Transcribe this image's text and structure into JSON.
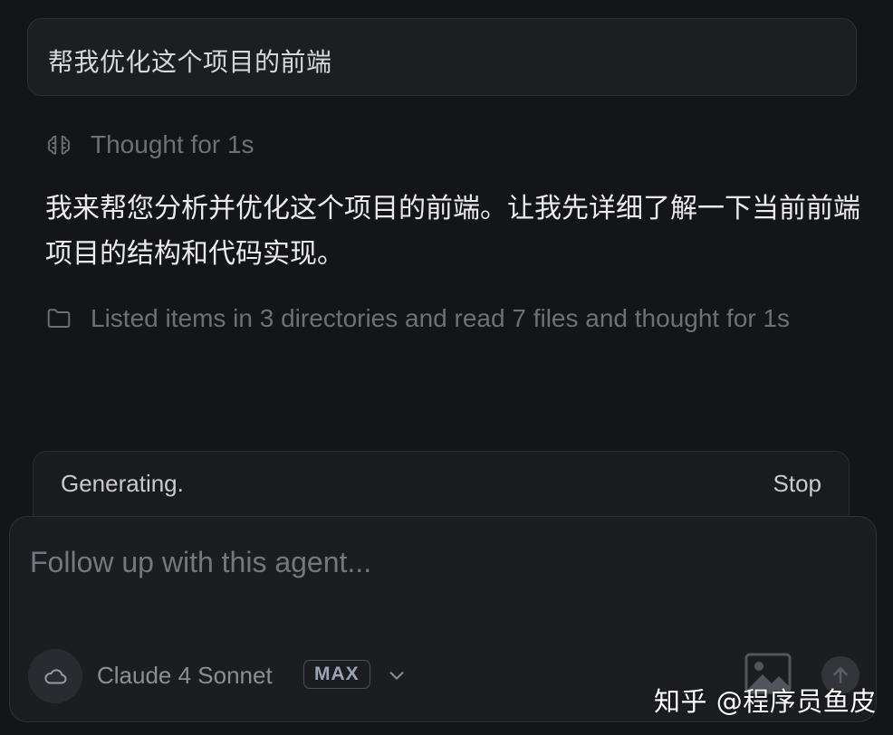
{
  "user_message": "帮我优化这个项目的前端",
  "thought": {
    "icon": "brain-icon",
    "text": "Thought for 1s"
  },
  "assistant_message": "我来帮您分析并优化这个项目的前端。让我先详细了解一下当前前端项目的结构和代码实现。",
  "activity": {
    "icon": "folder-icon",
    "text": "Listed items in 3 directories and read 7 files and thought for 1s"
  },
  "status_bar": {
    "status": "Generating.",
    "stop_label": "Stop"
  },
  "composer": {
    "placeholder": "Follow up with this agent...",
    "value": "",
    "model_icon": "cloud-icon",
    "model_name": "Claude 4 Sonnet",
    "model_badge": "MAX",
    "dropdown_icon": "chevron-down-icon",
    "image_icon": "image-icon",
    "send_icon": "arrow-up-icon"
  },
  "watermark": "知乎 @程序员鱼皮",
  "colors": {
    "background": "#141518",
    "panel": "#1c1d21",
    "muted_text": "#6f7077",
    "primary_text": "#ececef",
    "badge_text": "#9aa3b8"
  }
}
